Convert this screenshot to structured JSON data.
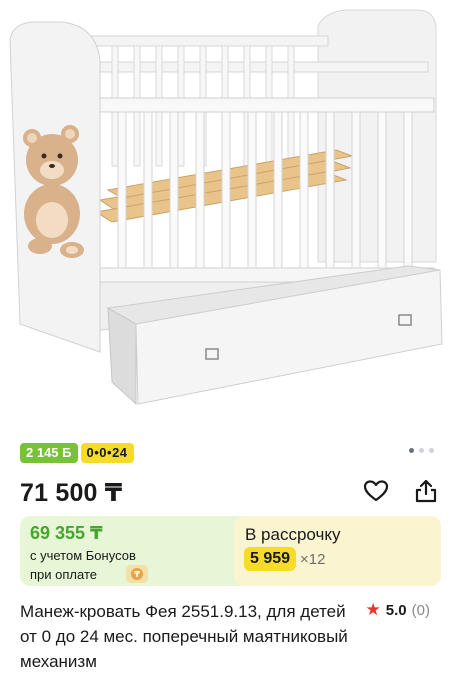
{
  "product_photo": {
    "icon": "baby-crib-photo"
  },
  "badges": {
    "bonus_points": "2 145 Б",
    "installment": "0•0•24"
  },
  "gallery_dots": [
    {
      "active": true
    },
    {
      "active": false
    },
    {
      "active": false
    }
  ],
  "price": {
    "main": "71 500 ₸"
  },
  "actions": {
    "favorite_icon": "heart-icon",
    "share_icon": "share-icon"
  },
  "bonus_card": {
    "price": "69 355 ₸",
    "note_line1": "с учетом Бонусов",
    "note_line2": "при оплате"
  },
  "installment_card": {
    "title": "В рассрочку",
    "monthly": "5 959",
    "multiplier": "×12"
  },
  "product": {
    "title": "Манеж-кровать Фея 2551.9.13, для детей от 0 до 24 мес. поперечный маятниковый механизм"
  },
  "rating": {
    "value": "5.0",
    "count": "(0)"
  },
  "colors": {
    "accent_green": "#48a52e",
    "badge_green": "#78c23a",
    "badge_yellow": "#f6dc29",
    "bonus_bg": "#e6f6d6",
    "install_bg": "#fbf4d0",
    "star_red": "#e8342b"
  }
}
